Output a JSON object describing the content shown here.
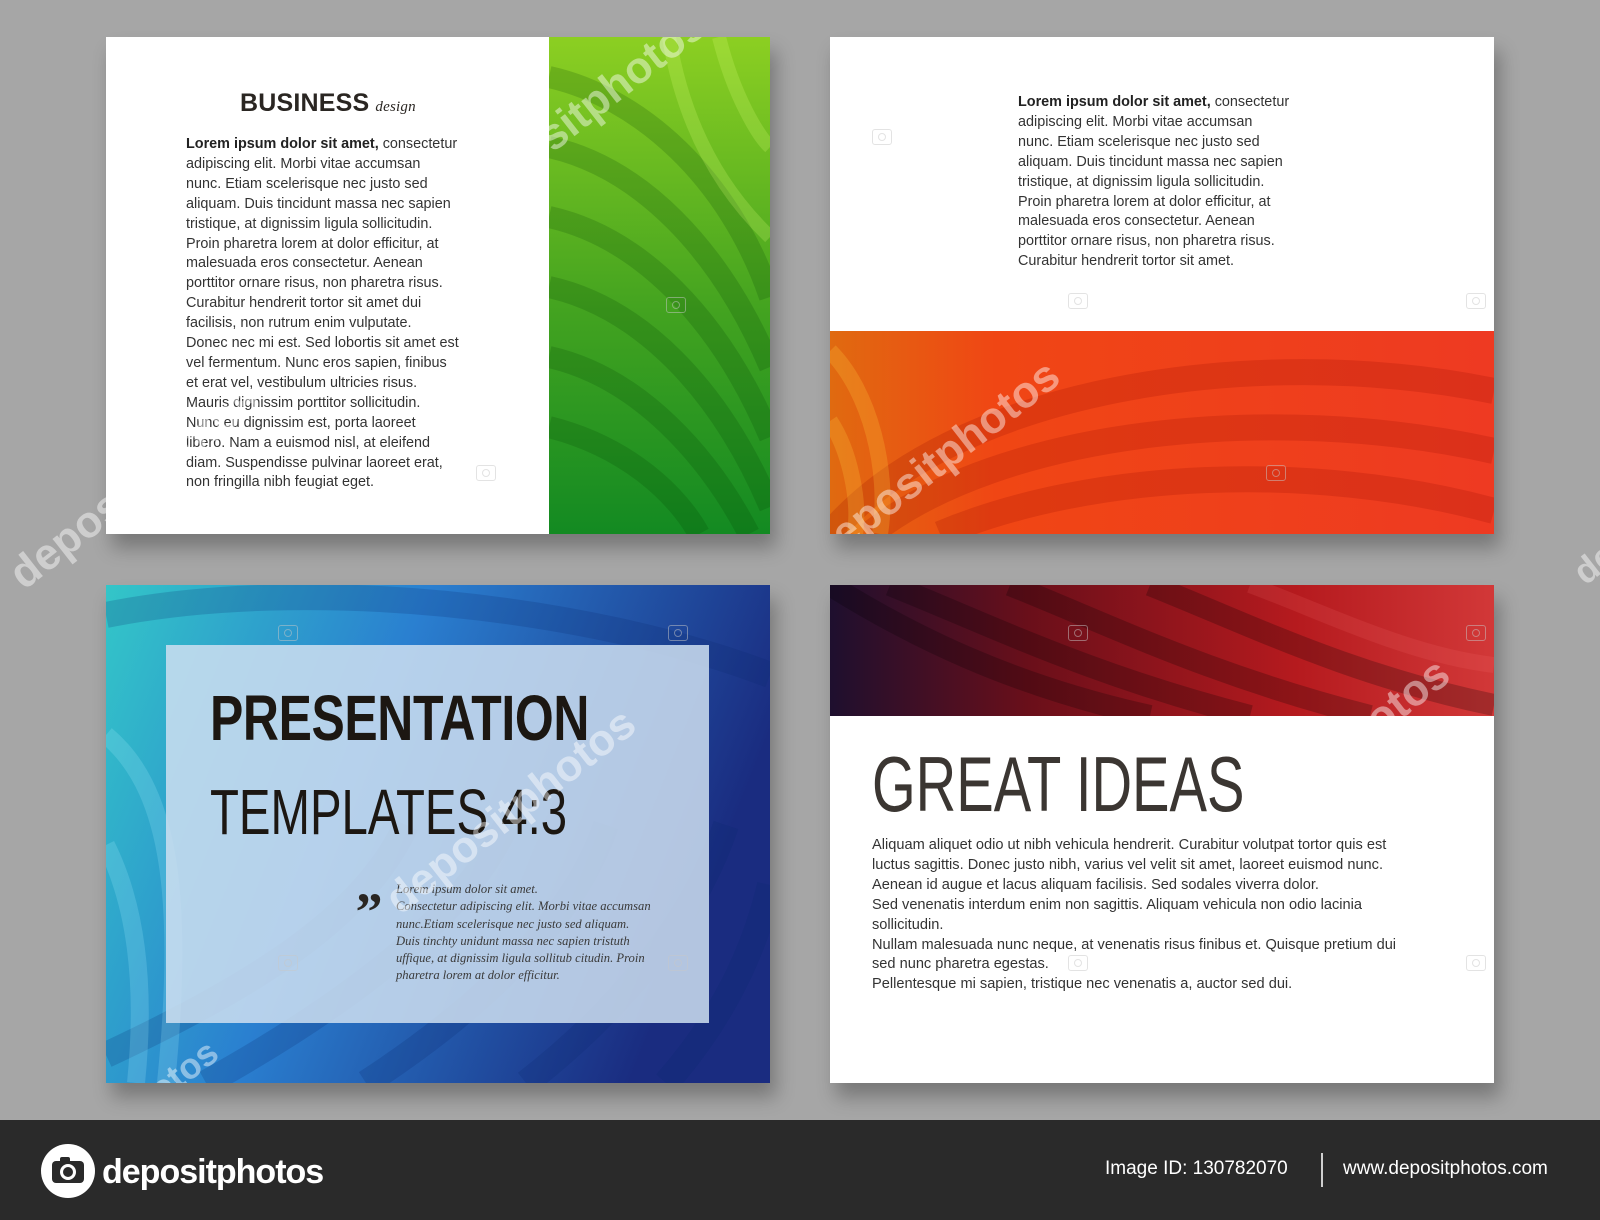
{
  "slide1": {
    "title": "BUSINESS",
    "subtitle": "design",
    "lead": "Lorem ipsum dolor sit amet,",
    "body": " consectetur\nadipiscing elit. Morbi vitae accumsan\nnunc. Etiam scelerisque nec justo sed\naliquam. Duis tincidunt massa nec sapien\ntristique, at dignissim ligula sollicitudin.\nProin pharetra lorem at dolor efficitur, at\nmalesuada eros consectetur. Aenean\nporttitor ornare risus, non pharetra risus.\nCurabitur hendrerit tortor sit amet dui\nfacilisis, non rutrum enim vulputate.\nDonec nec mi est. Sed lobortis sit amet est\nvel fermentum. Nunc eros sapien, finibus\net erat vel, vestibulum ultricies risus.\nMauris dignissim porttitor sollicitudin.\nNunc eu dignissim est, porta laoreet\nlibero. Nam a euismod nisl, at eleifend\ndiam. Suspendisse pulvinar laoreet erat,\nnon fringilla nibh feugiat eget."
  },
  "slide2": {
    "lead": "Lorem ipsum dolor sit amet,",
    "body": " consectetur\nadipiscing elit. Morbi vitae accumsan\nnunc. Etiam scelerisque nec justo sed\naliquam. Duis tincidunt massa nec sapien\ntristique, at dignissim ligula sollicitudin.\nProin pharetra lorem at dolor efficitur, at\nmalesuada eros consectetur. Aenean\nporttitor ornare risus, non pharetra risus.\nCurabitur hendrerit tortor sit amet."
  },
  "slide3": {
    "line1": "PRESENTATION",
    "line2": "TEMPLATES   4:3",
    "quote_mark": "„",
    "quote": "Lorem ipsum dolor sit amet.\nConsectetur adipiscing elit. Morbi vitae accumsan\nnunc.Etiam scelerisque nec justo sed aliquam.\nDuis tinchty unidunt massa nec sapien tristuth\nuffique, at dignissim ligula sollitub citudin. Proin\npharetra lorem at dolor efficitur."
  },
  "slide4": {
    "title": "GREAT IDEAS",
    "body": "Aliquam aliquet odio ut nibh vehicula hendrerit. Curabitur volutpat tortor quis est\nluctus sagittis. Donec justo nibh, varius vel velit sit amet, laoreet euismod nunc.\nAenean id augue et lacus aliquam facilisis. Sed sodales viverra dolor.\nSed venenatis interdum enim non sagittis. Aliquam vehicula non odio lacinia\nsollicitudin.\nNullam malesuada nunc neque, at venenatis risus finibus et. Quisque pretium dui\nsed nunc pharetra egestas.\nPellentesque mi sapien, tristique nec venenatis a, auctor sed dui."
  },
  "watermark": {
    "text": "depositphotos",
    "fragment_left": "photos",
    "fragment_right": "de"
  },
  "footer": {
    "logo": "depositphotos",
    "image_id": "Image ID: 130782070",
    "url": "www.depositphotos.com"
  },
  "colors": {
    "background": "#a6a6a6",
    "green_band": "#3f9d1c",
    "red_band": "#e8351e",
    "teal_blue": "#1f4fa3",
    "dark_red": "#8e1418",
    "footer": "#2a2a2a"
  },
  "icons": {
    "logo_icon": "camera-icon",
    "watermark_icon": "camera-icon"
  }
}
